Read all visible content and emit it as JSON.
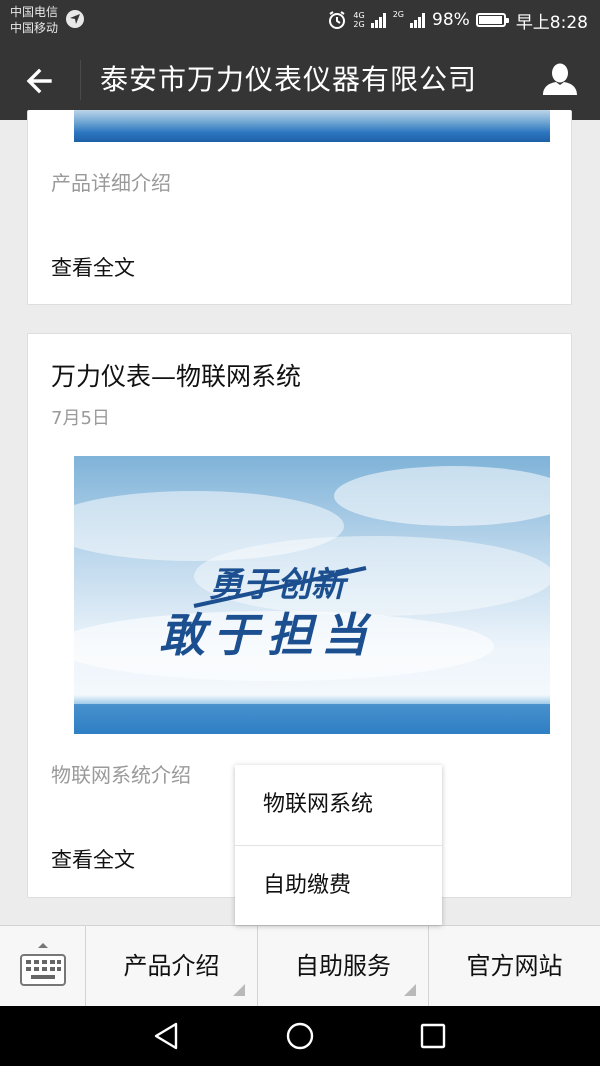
{
  "status_bar": {
    "carrier_1": "中国电信",
    "carrier_2": "中国移动",
    "net_1_top": "4G",
    "net_1_bottom": "2G",
    "net_2": "2G",
    "battery": "98%",
    "battery_level": 0.98,
    "time": "早上8:28"
  },
  "header": {
    "title": "泰安市万力仪表仪器有限公司",
    "back_icon": "arrow-left-icon",
    "profile_icon": "person-icon"
  },
  "articles": [
    {
      "description": "产品详细介绍",
      "read_more": "查看全文"
    },
    {
      "title": "万力仪表—物联网系统",
      "date": "7月5日",
      "cover_slogan_1": "勇于创新",
      "cover_slogan_2": "敢于担当",
      "description": "物联网系统介绍",
      "read_more": "查看全文"
    }
  ],
  "popup_menu": {
    "items": [
      "物联网系统",
      "自助缴费"
    ]
  },
  "bottom_menu": {
    "keyboard_icon": "keyboard-icon",
    "items": [
      "产品介绍",
      "自助服务",
      "官方网站"
    ]
  },
  "nav_bar": {
    "back_icon": "triangle-back-icon",
    "home_icon": "circle-home-icon",
    "recents_icon": "square-recents-icon"
  },
  "colors": {
    "header_bg": "#353535",
    "page_bg": "#ececec",
    "muted_text": "#9a9a9a"
  }
}
